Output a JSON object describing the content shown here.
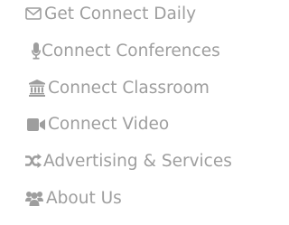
{
  "menu": {
    "items": [
      {
        "label": "Get Connect Daily",
        "icon": "envelope-icon"
      },
      {
        "label": "Connect Conferences",
        "icon": "microphone-icon"
      },
      {
        "label": "Connect Classroom",
        "icon": "institution-icon"
      },
      {
        "label": "Connect Video",
        "icon": "video-camera-icon"
      },
      {
        "label": "Advertising & Services",
        "icon": "random-icon"
      },
      {
        "label": "About Us",
        "icon": "users-icon"
      }
    ]
  },
  "colors": {
    "text": "#9e9e9e",
    "background": "#ffffff"
  }
}
